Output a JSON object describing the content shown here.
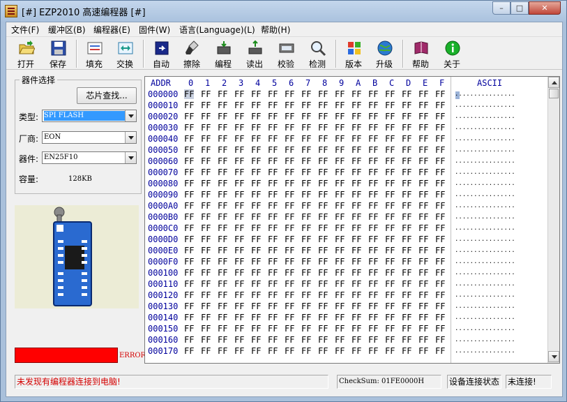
{
  "window": {
    "title": "[#] EZP2010 高速编程器 [#]",
    "min": "–",
    "max": "□",
    "close": "✕"
  },
  "menu": [
    "文件(F)",
    "缓冲区(B)",
    "编程器(E)",
    "固件(W)",
    "语言(Language)(L)",
    "帮助(H)"
  ],
  "toolbar": [
    {
      "label": "打开",
      "icon": "open-folder-icon"
    },
    {
      "label": "保存",
      "icon": "save-disk-icon"
    },
    {
      "label": "填充",
      "icon": "fill-icon"
    },
    {
      "label": "交换",
      "icon": "swap-icon"
    },
    {
      "label": "自动",
      "icon": "auto-icon"
    },
    {
      "label": "擦除",
      "icon": "erase-brush-icon"
    },
    {
      "label": "编程",
      "icon": "program-chip-icon"
    },
    {
      "label": "读出",
      "icon": "read-chip-icon"
    },
    {
      "label": "校验",
      "icon": "verify-chip-icon"
    },
    {
      "label": "检测",
      "icon": "detect-magnifier-icon"
    },
    {
      "label": "版本",
      "icon": "version-icon"
    },
    {
      "label": "升级",
      "icon": "upgrade-globe-icon"
    },
    {
      "label": "帮助",
      "icon": "help-book-icon"
    },
    {
      "label": "关于",
      "icon": "about-info-icon"
    }
  ],
  "chip_select": {
    "group_title": "器件选择",
    "find_button": "芯片查找...",
    "type_label": "类型:",
    "type_value": "SPI FLASH",
    "vendor_label": "厂商:",
    "vendor_value": "EON",
    "device_label": "器件:",
    "device_value": "EN25F10",
    "capacity_label": "容量:",
    "capacity_value": "128KB"
  },
  "error_label": "ERROR",
  "hex_view": {
    "addr_header": "ADDR",
    "columns": [
      "0",
      "1",
      "2",
      "3",
      "4",
      "5",
      "6",
      "7",
      "8",
      "9",
      "A",
      "B",
      "C",
      "D",
      "E",
      "F"
    ],
    "ascii_header": "ASCII",
    "addresses": [
      "000000",
      "000010",
      "000020",
      "000030",
      "000040",
      "000050",
      "000060",
      "000070",
      "000080",
      "000090",
      "0000A0",
      "0000B0",
      "0000C0",
      "0000D0",
      "0000E0",
      "0000F0",
      "000100",
      "000110",
      "000120",
      "000130",
      "000140",
      "000150",
      "000160",
      "000170"
    ],
    "byte_value": "FF",
    "ascii_row": "................"
  },
  "status": {
    "message": "未发现有编程器连接到电脑!",
    "checksum": "CheckSum: 01FE0000H",
    "device_state_label": "设备连接状态",
    "connection": "未连接!"
  }
}
